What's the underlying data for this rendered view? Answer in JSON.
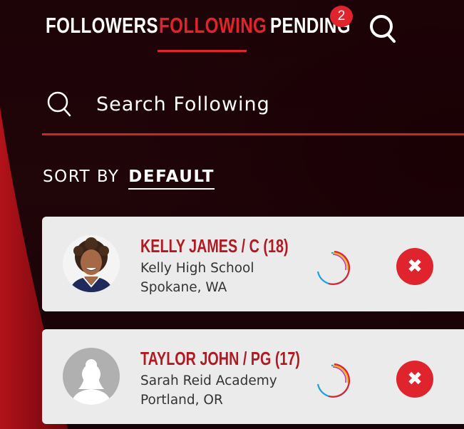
{
  "tabs": [
    {
      "label": "FOLLOWERS",
      "active": false
    },
    {
      "label": "FOLLOWING",
      "active": true
    },
    {
      "label": "PENDING",
      "active": false,
      "badge": "2"
    }
  ],
  "icons": {
    "top_search": "search-icon",
    "field_search": "search-icon",
    "remove": "close-icon",
    "loading": "spinner-icon"
  },
  "search": {
    "placeholder": "Search Following"
  },
  "sort": {
    "label": "SORT BY",
    "value": "DEFAULT"
  },
  "following": [
    {
      "name": "KELLY JAMES / C (18)",
      "school": "Kelly High School",
      "location": "Spokane, WA",
      "avatar": "photo"
    },
    {
      "name": "TAYLOR JOHN / PG (17)",
      "school": "Sarah Reid Academy",
      "location": "Portland, OR",
      "avatar": "placeholder-silhouette"
    }
  ],
  "colors": {
    "accent": "#e0242d",
    "name": "#b01a22",
    "card": "#ebebeb",
    "background": "#1d0407"
  }
}
